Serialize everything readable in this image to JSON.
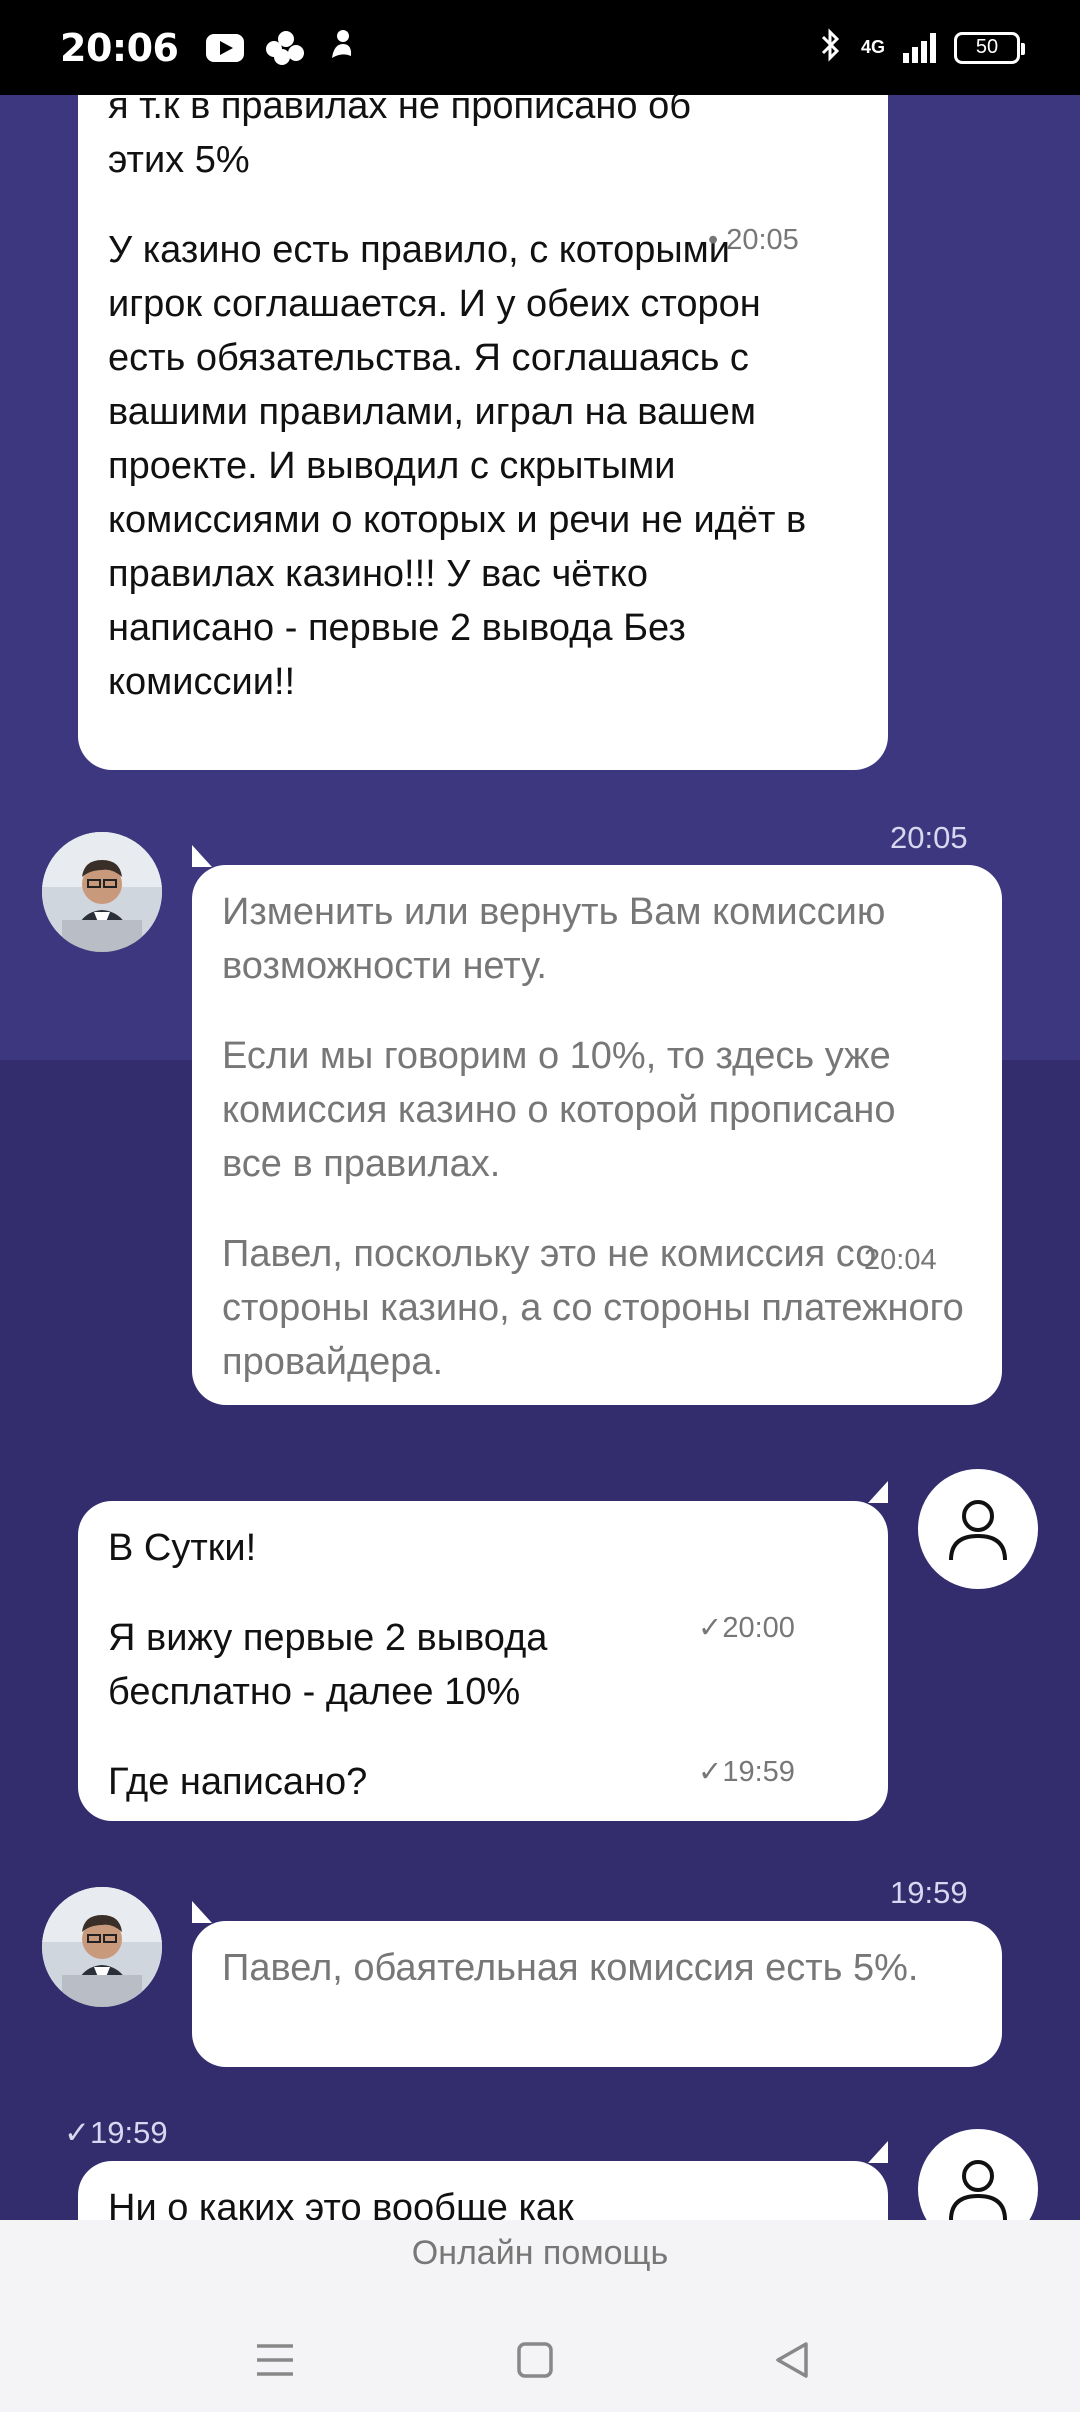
{
  "status_bar": {
    "time": "20:06",
    "network": "4G",
    "battery": "50",
    "icons": [
      "youtube-icon",
      "app-dots-icon",
      "notification-icon",
      "bluetooth-icon",
      "signal-icon",
      "battery-icon"
    ]
  },
  "chat": {
    "msg1": {
      "line0": "я т.к в правилах не прописано об",
      "line1": "этих 5%",
      "p2": "У казино есть правило, с которыми игрок соглашается. И у обеих сторон есть обязательства. Я соглашаясь с вашими правилами, играл на вашем проекте. И выводил с скрытыми комиссиями о которых и речи не идёт  в правилах казино!!! У вас чётко написано - первые 2 вывода Без комиссии!!",
      "time": "20:05"
    },
    "msg2": {
      "header_time": "20:05",
      "p1": "Изменить или вернуть Вам комиссию возможности нету.",
      "p2": "Если мы говорим о 10%, то здесь уже комиссия казино о которой прописано все в правилах.",
      "p3": "Павел, поскольку это не комиссия со стороны казино, а со стороны платежного провайдера.",
      "time": "20:04"
    },
    "msg3": {
      "p1": "В Сутки!",
      "p2": "Я вижу первые 2 вывода бесплатно - далее 10%",
      "p2_time": "20:00",
      "p3": "Где написано?",
      "p3_time": "19:59"
    },
    "msg4": {
      "header_time": "19:59",
      "p1": "Павел, обаятельная комиссия есть 5%."
    },
    "msg5": {
      "header_time": "19:59",
      "p1": "Ни о каких это вообще как"
    }
  },
  "footer": {
    "label": "Онлайн помощь",
    "nav": [
      "menu-icon",
      "home-icon",
      "back-icon"
    ]
  }
}
